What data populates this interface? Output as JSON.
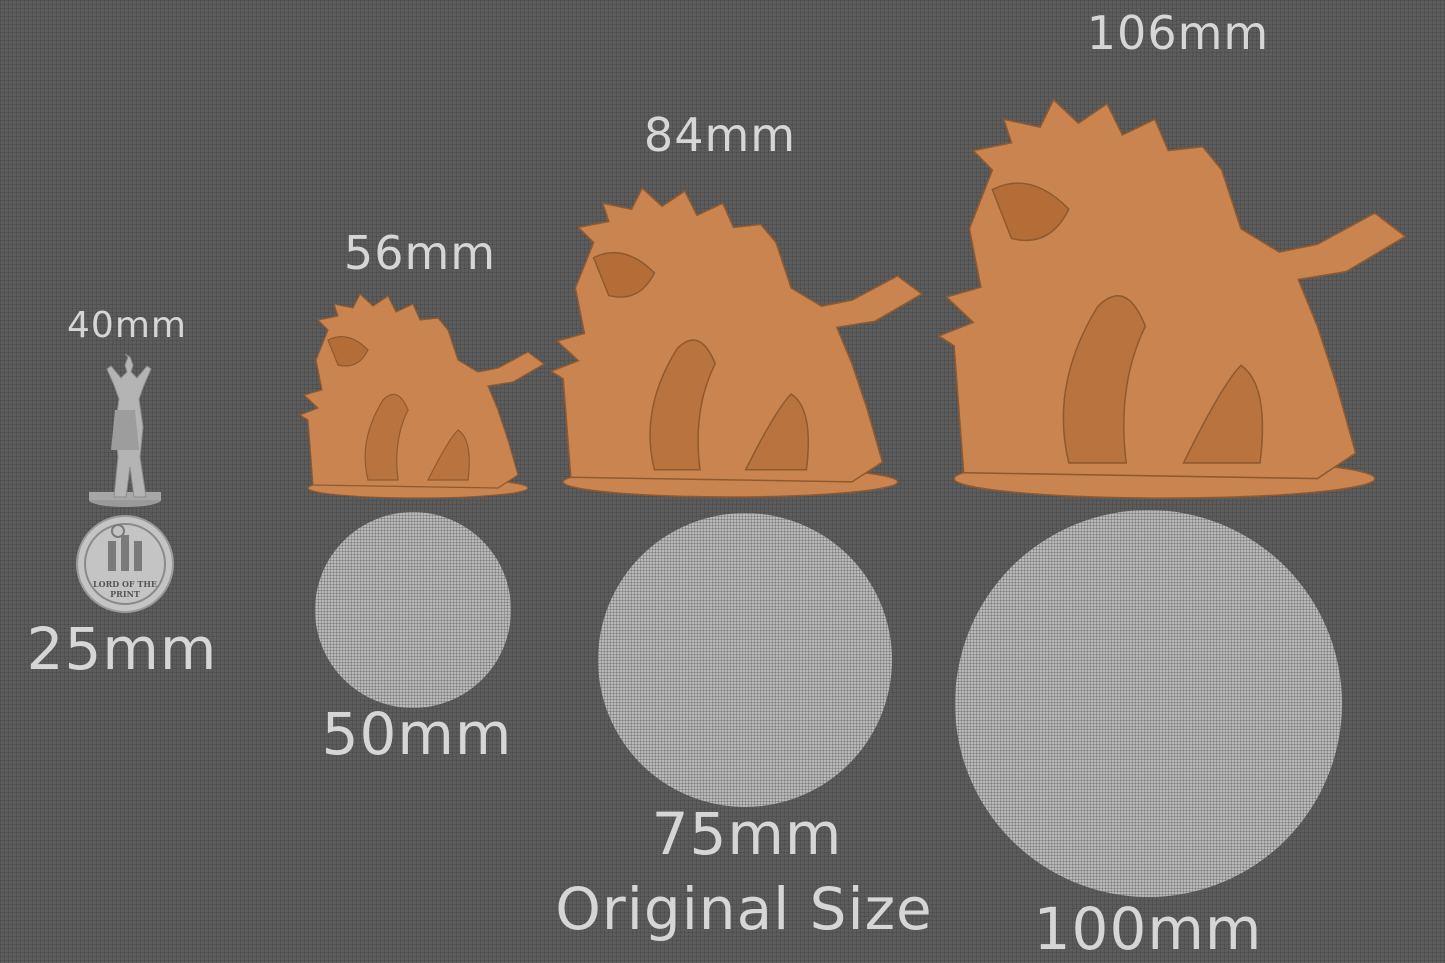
{
  "sizes": {
    "human_height": "40mm",
    "coin_base": "25mm",
    "small_height": "56mm",
    "small_base": "50mm",
    "medium_height": "84mm",
    "medium_base": "75mm",
    "medium_note": "Original Size",
    "large_height": "106mm",
    "large_base": "100mm"
  },
  "logo": {
    "text": "LORD OF THE PRINT"
  },
  "colors": {
    "background": "#5c5c5c",
    "monster": "#c98450",
    "human_figure": "#b0b0b0",
    "base": "#b9b9b9",
    "text": "#d6d6d6"
  },
  "icons": {
    "human": "human-miniature-icon",
    "monster": "monster-miniature-icon",
    "logo": "lord-of-the-print-logo"
  }
}
